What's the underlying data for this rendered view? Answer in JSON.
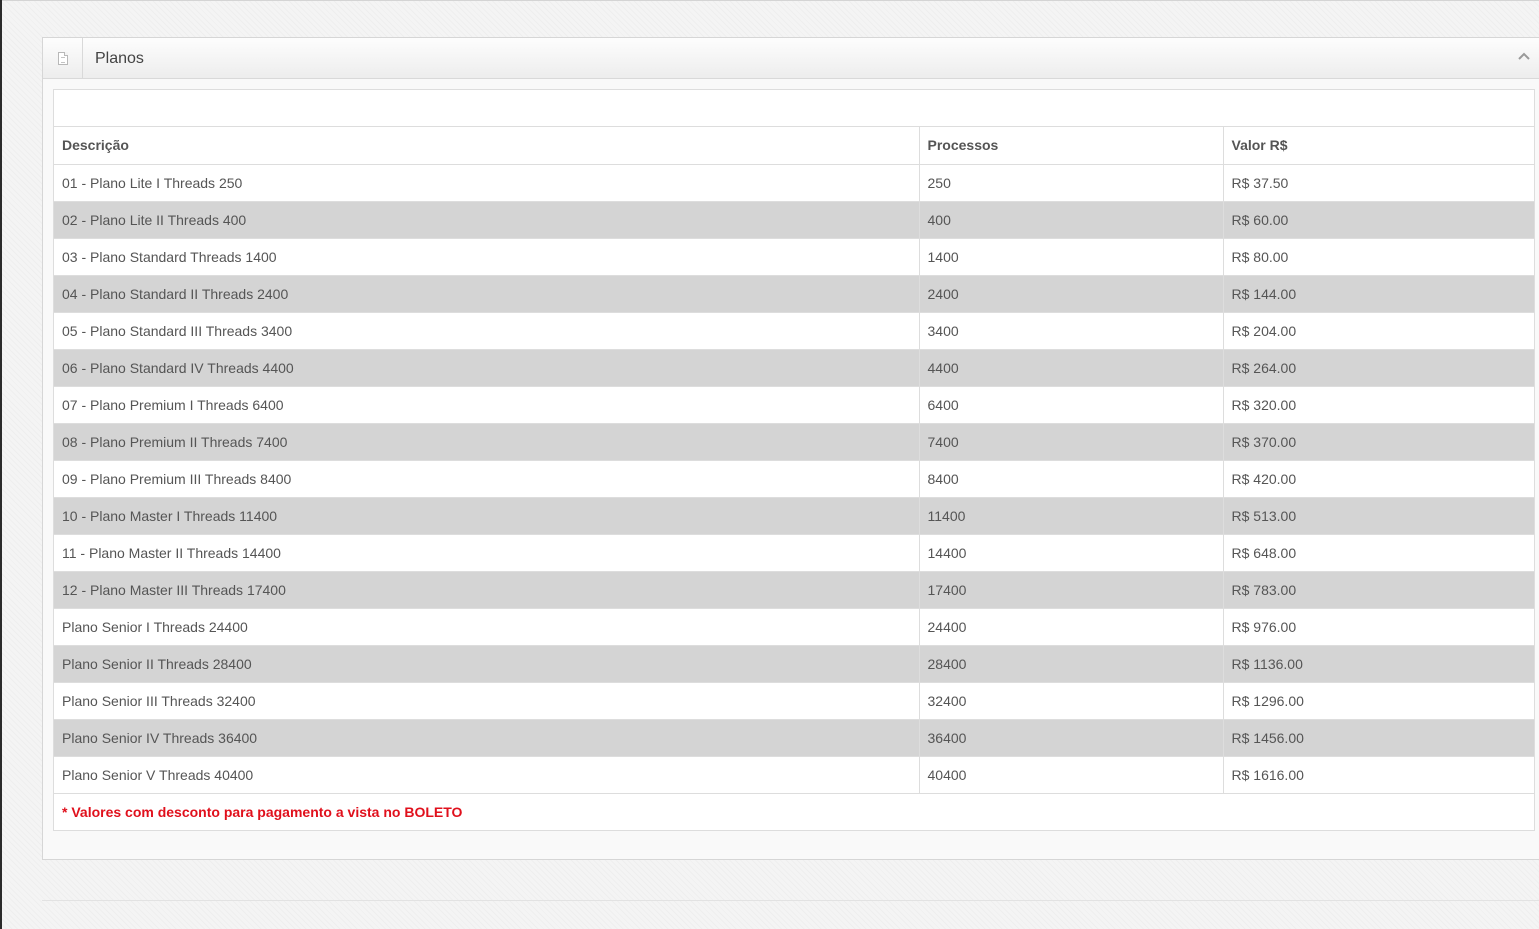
{
  "panel": {
    "title": "Planos",
    "icon": "document-icon",
    "collapse_icon": "chevron-up-icon"
  },
  "table": {
    "columns": [
      "Descrição",
      "Processos",
      "Valor R$"
    ],
    "rows": [
      [
        "01 - Plano Lite I Threads 250",
        "250",
        "R$ 37.50"
      ],
      [
        "02 - Plano Lite II Threads 400",
        "400",
        "R$ 60.00"
      ],
      [
        "03 - Plano Standard Threads 1400",
        "1400",
        "R$ 80.00"
      ],
      [
        "04 - Plano Standard II Threads 2400",
        "2400",
        "R$ 144.00"
      ],
      [
        "05 - Plano Standard III Threads 3400",
        "3400",
        "R$ 204.00"
      ],
      [
        "06 - Plano Standard IV Threads 4400",
        "4400",
        "R$ 264.00"
      ],
      [
        "07 - Plano Premium I Threads 6400",
        "6400",
        "R$ 320.00"
      ],
      [
        "08 - Plano Premium II Threads 7400",
        "7400",
        "R$ 370.00"
      ],
      [
        "09 - Plano Premium III Threads 8400",
        "8400",
        "R$ 420.00"
      ],
      [
        "10 - Plano Master I Threads 11400",
        "11400",
        "R$ 513.00"
      ],
      [
        "11 - Plano Master II Threads 14400",
        "14400",
        "R$ 648.00"
      ],
      [
        "12 - Plano Master III Threads 17400",
        "17400",
        "R$ 783.00"
      ],
      [
        "Plano Senior I Threads 24400",
        "24400",
        "R$ 976.00"
      ],
      [
        "Plano Senior II Threads 28400",
        "28400",
        "R$ 1136.00"
      ],
      [
        "Plano Senior III Threads 32400",
        "32400",
        "R$ 1296.00"
      ],
      [
        "Plano Senior IV Threads 36400",
        "36400",
        "R$ 1456.00"
      ],
      [
        "Plano Senior V Threads 40400",
        "40400",
        "R$ 1616.00"
      ]
    ]
  },
  "footnote": "* Valores com desconto para pagamento a vista no BOLETO",
  "colors": {
    "footnote": "#e0101c",
    "row_stripe": "#d4d4d4",
    "border": "#dddddd"
  }
}
